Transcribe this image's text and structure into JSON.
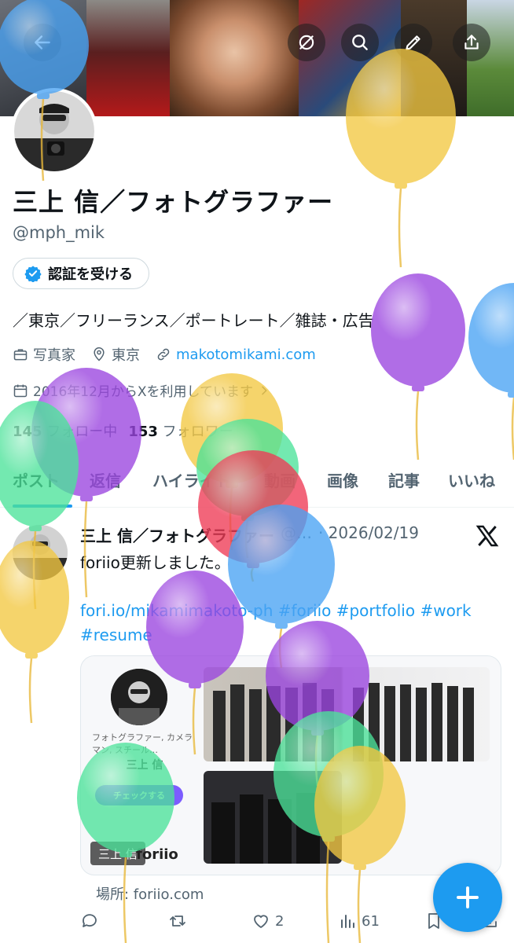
{
  "colors": {
    "accent": "#1d9bf0",
    "text": "#0f1419",
    "muted": "#536471",
    "balloon_blue": "#4aa3f4",
    "balloon_yellow": "#f3c842",
    "balloon_purple": "#9b45e0",
    "balloon_green": "#4ce39a",
    "balloon_red": "#ef3b56"
  },
  "header": {
    "back_icon": "arrow-left-icon",
    "actions": [
      "grok-icon",
      "search-icon",
      "pencil-icon",
      "share-icon"
    ]
  },
  "profile": {
    "name": "三上 信／フォトグラファー",
    "handle": "@mph_mik",
    "verify_label": "認証を受ける",
    "bio": "／東京／フリーランス／ポートレート／雑誌・広告",
    "profession": "写真家",
    "location": "東京",
    "website": "makotomikami.com",
    "joined": "2016年12月からXを利用しています",
    "following_count": "145",
    "following_label": "フォロー中",
    "followers_count": "153",
    "followers_label": "フォロワー"
  },
  "tabs": [
    {
      "label": "ポスト",
      "active": true
    },
    {
      "label": "返信"
    },
    {
      "label": "ハイライト"
    },
    {
      "label": "動画"
    },
    {
      "label": "画像"
    },
    {
      "label": "記事"
    },
    {
      "label": "いいね"
    }
  ],
  "post": {
    "author": "三上 信／フォトグラファー",
    "handle_meta": "@…",
    "date": "· 2026/02/19",
    "text": "foriio更新しました。",
    "links": "fori.io/mikamimakoto-ph #foriio #portfolio #work #resume",
    "card": {
      "desc": "フォトグラファー, カメラマン, スチール…",
      "title": "三上 信",
      "check": "チェックする",
      "label": "三上 信",
      "logo": "foriio"
    },
    "location": "場所: foriio.com",
    "stats": {
      "replies": "",
      "reposts": "",
      "likes": "2",
      "views": "61"
    }
  },
  "fab_label": "+"
}
